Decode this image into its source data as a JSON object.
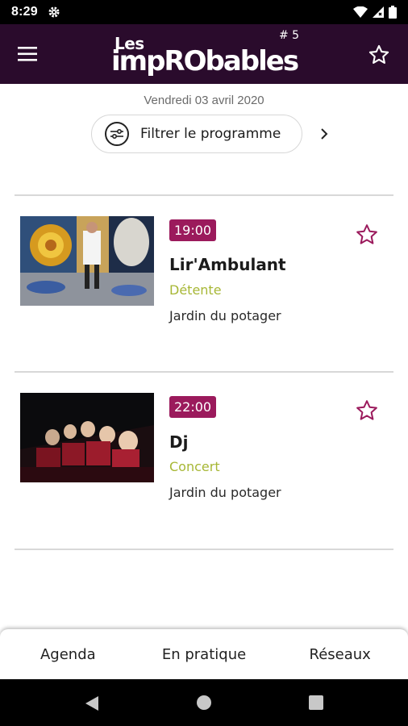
{
  "status_bar": {
    "time": "8:29",
    "icons": [
      "settings-icon",
      "wifi-icon",
      "signal-icon",
      "battery-icon"
    ]
  },
  "app_bar": {
    "logo": {
      "les": "Les",
      "name": "impRObables",
      "edition": "# 5"
    },
    "menu_icon": "hamburger-menu-icon",
    "favorite_icon": "star-outline-icon"
  },
  "date": "Vendredi 03 avril 2020",
  "filter": {
    "label": "Filtrer le programme",
    "icon": "sliders-icon",
    "next_icon": "chevron-right-icon"
  },
  "events": [
    {
      "time": "19:00",
      "title": "Lir'Ambulant",
      "category": "Détente",
      "place": "Jardin du potager",
      "image": "performer-mural-photo"
    },
    {
      "time": "22:00",
      "title": "Dj",
      "category": "Concert",
      "place": "Jardin du potager",
      "image": "cinema-audience-photo"
    }
  ],
  "bottom_nav": {
    "items": [
      {
        "label": "Agenda"
      },
      {
        "label": "En pratique"
      },
      {
        "label": "Réseaux"
      }
    ]
  },
  "colors": {
    "app_bar": "#2a0b2c",
    "accent": "#9b1a5c",
    "category": "#a7b735",
    "divider": "#d8d8d8"
  }
}
